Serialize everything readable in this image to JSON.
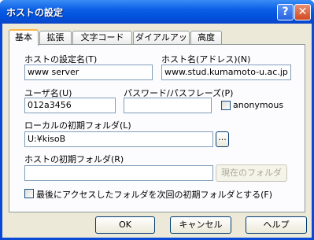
{
  "window": {
    "title": "ホストの設定"
  },
  "tabs": [
    "基本",
    "拡張",
    "文字コード",
    "ダイアルアップ",
    "高度"
  ],
  "form": {
    "host_label": "ホストの設定名(T)",
    "host_value": "www server",
    "hostname_label": "ホスト名(アドレス)(N)",
    "hostname_value": "www.stud.kumamoto-u.ac.jp",
    "user_label": "ユーザ名(U)",
    "user_value": "012a3456",
    "password_label": "パスワード/パスフレーズ(P)",
    "password_value": "",
    "anonymous_label": "anonymous",
    "local_label": "ローカルの初期フォルダ(L)",
    "local_value": "U:¥kisoB",
    "browse_label": "...",
    "remote_label": "ホストの初期フォルダ(R)",
    "remote_value": "",
    "current_folder_label": "現在のフォルダ",
    "last_folder_label": "最後にアクセスしたフォルダを次回の初期フォルダとする(F)"
  },
  "buttons": {
    "ok": "OK",
    "cancel": "キャンセル",
    "help": "ヘルプ"
  }
}
